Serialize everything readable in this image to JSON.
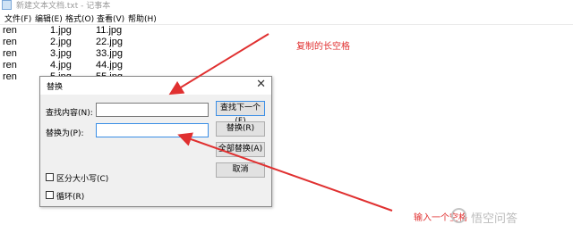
{
  "window": {
    "title": "新建文本文档.txt - 记事本"
  },
  "menu": [
    "文件(F)",
    "编辑(E)",
    "格式(O)",
    "查看(V)",
    "帮助(H)"
  ],
  "editor_lines": [
    [
      "ren",
      "1.jpg",
      "11.jpg"
    ],
    [
      "ren",
      "2.jpg",
      "22.jpg"
    ],
    [
      "ren",
      "3.jpg",
      "33.jpg"
    ],
    [
      "ren",
      "4.jpg",
      "44.jpg"
    ],
    [
      "ren",
      "5.jpg",
      "55.jpg"
    ]
  ],
  "dialog": {
    "title": "替换",
    "close": "✕",
    "find_label": "查找内容(N):",
    "find_value": "",
    "replace_label": "替换为(P):",
    "replace_value": "",
    "buttons": {
      "find_next": "查找下一个(F)",
      "replace": "替换(R)",
      "replace_all": "全部替换(A)",
      "cancel": "取消"
    },
    "match_case": "区分大小写(C)",
    "wrap": "循环(R)"
  },
  "annotations": {
    "copied_long_space": "复制的长空格",
    "input_space": "输入一个空格"
  },
  "watermark": "悟空问答",
  "colors": {
    "annotation": "#e03030",
    "focus_border": "#3a8ee6"
  }
}
